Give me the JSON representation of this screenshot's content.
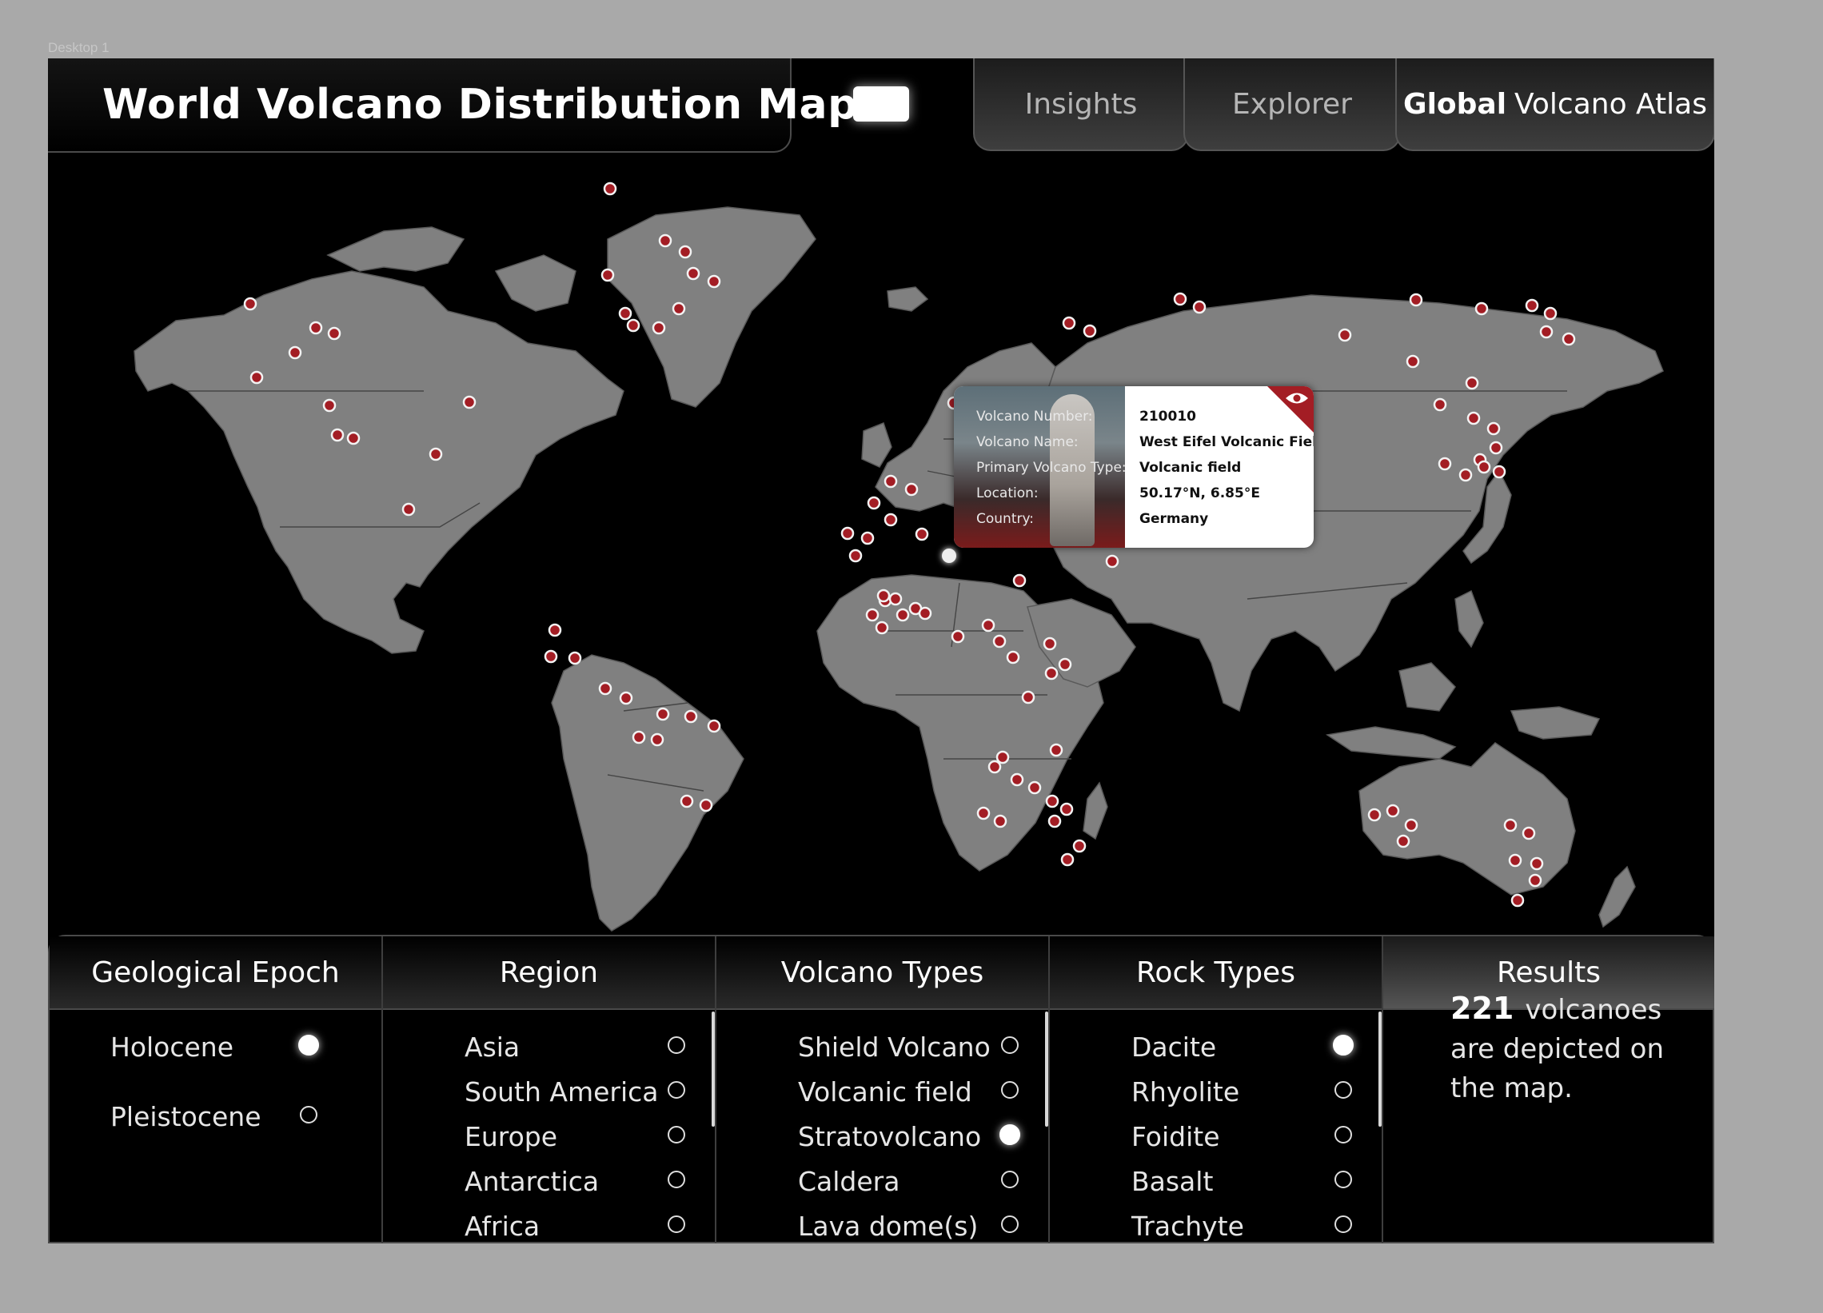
{
  "frame_label": "Desktop 1",
  "header": {
    "title": "World Volcano Distribution Map",
    "tabs": [
      {
        "label": "Insights"
      },
      {
        "label": "Explorer"
      },
      {
        "label_bold": "Global",
        "label": "Volcano Atlas"
      }
    ]
  },
  "tooltip": {
    "labels": [
      "Volcano Number:",
      "Volcano Name:",
      "Primary Volcano Type:",
      "Location:",
      "Country:"
    ],
    "volcano_number": "210010",
    "volcano_name": "West Eifel Volcanic Field",
    "primary_volcano_type": "Volcanic field",
    "location": "50.17°N, 6.85°E",
    "country": "Germany",
    "icon": "eye-icon"
  },
  "colors": {
    "pin": "#a31d24",
    "land": "#808080",
    "background": "#000000",
    "accent": "#ffffff"
  },
  "filters": {
    "epoch": {
      "title": "Geological Epoch",
      "options": [
        {
          "label": "Holocene",
          "selected": true
        },
        {
          "label": "Pleistocene",
          "selected": false
        }
      ]
    },
    "region": {
      "title": "Region",
      "options": [
        {
          "label": "Asia",
          "selected": false
        },
        {
          "label": "South America",
          "selected": false
        },
        {
          "label": "Europe",
          "selected": false
        },
        {
          "label": "Antarctica",
          "selected": false
        },
        {
          "label": "Africa",
          "selected": false
        }
      ]
    },
    "volcano_types": {
      "title": "Volcano Types",
      "options": [
        {
          "label": "Shield Volcano",
          "selected": false
        },
        {
          "label": "Volcanic field",
          "selected": false
        },
        {
          "label": "Stratovolcano",
          "selected": true
        },
        {
          "label": "Caldera",
          "selected": false
        },
        {
          "label": "Lava dome(s)",
          "selected": false
        }
      ]
    },
    "rock_types": {
      "title": "Rock Types",
      "options": [
        {
          "label": "Dacite",
          "selected": true
        },
        {
          "label": "Rhyolite",
          "selected": false
        },
        {
          "label": "Foidite",
          "selected": false
        },
        {
          "label": "Basalt",
          "selected": false
        },
        {
          "label": "Trachyte",
          "selected": false
        }
      ]
    },
    "results": {
      "title": "Results",
      "count": "221",
      "text": "volcanoes are depicted on the map."
    }
  }
}
